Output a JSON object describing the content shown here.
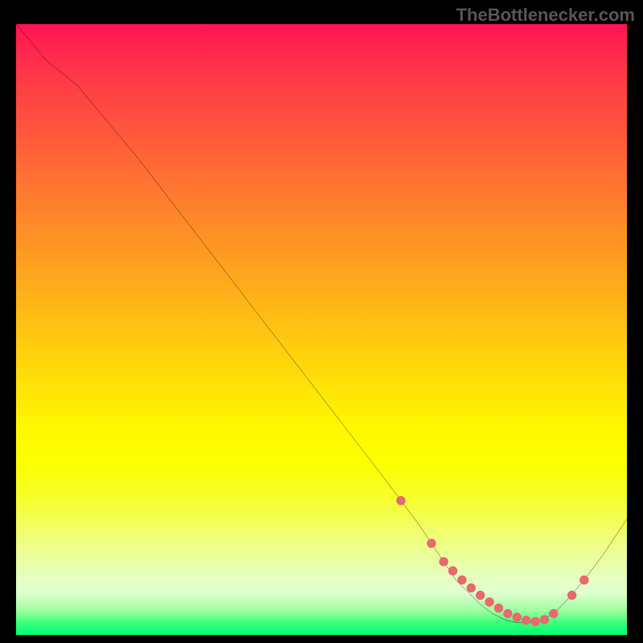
{
  "watermark": "TheBottlenecker.com",
  "colors": {
    "page_bg": "#000000",
    "watermark": "#555555",
    "curve": "#000000",
    "dot": "#e76a6c",
    "gradient_top": "#ff1452",
    "gradient_bottom": "#00ff70"
  },
  "chart_data": {
    "type": "line",
    "title": "",
    "xlabel": "",
    "ylabel": "",
    "x_range": [
      0,
      100
    ],
    "y_range": [
      0,
      100
    ],
    "series": [
      {
        "name": "curve",
        "x": [
          0,
          5,
          7.5,
          10,
          15,
          20,
          25,
          30,
          35,
          40,
          45,
          50,
          55,
          60,
          63,
          66,
          68,
          70,
          72,
          74,
          76,
          78,
          80,
          82,
          84,
          85,
          86,
          88,
          90,
          93,
          96,
          100
        ],
        "y": [
          100,
          94,
          92,
          90,
          84,
          78,
          71.5,
          65,
          58.5,
          52,
          45.5,
          39,
          32.5,
          26,
          22,
          18,
          15,
          12,
          9,
          7,
          5,
          3.5,
          2.5,
          2,
          2,
          2.2,
          2.5,
          3.5,
          5.5,
          9,
          13,
          19
        ]
      }
    ],
    "points": {
      "name": "dots",
      "x": [
        63,
        68,
        70,
        71.5,
        73,
        74.5,
        76,
        77.5,
        79,
        80.5,
        82,
        83.5,
        85,
        86.5,
        88,
        91,
        93
      ],
      "y": [
        22,
        15,
        12,
        10.5,
        9,
        7.7,
        6.5,
        5.4,
        4.4,
        3.5,
        2.9,
        2.4,
        2.2,
        2.5,
        3.5,
        6.5,
        9
      ]
    },
    "annotations": []
  }
}
